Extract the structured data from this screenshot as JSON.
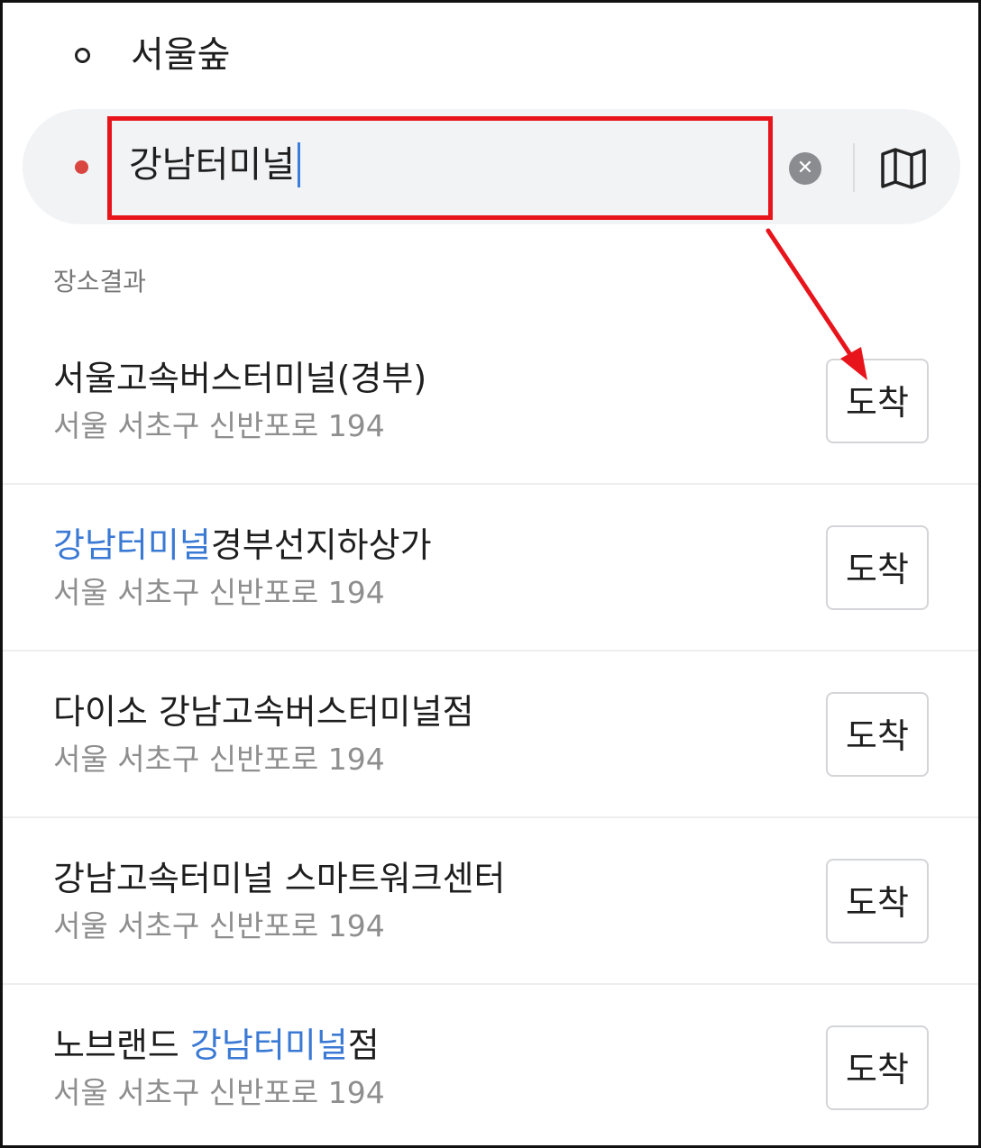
{
  "origin": {
    "label": "서울숲"
  },
  "search": {
    "value": "강남터미널"
  },
  "section": {
    "label": "장소결과"
  },
  "results": [
    {
      "pre": "서울고속버스터미널(경부)",
      "hl": "",
      "post": "",
      "address": "서울 서초구 신반포로 194",
      "button": "도착"
    },
    {
      "pre": "",
      "hl": "강남터미널",
      "post": "경부선지하상가",
      "address": "서울 서초구 신반포로 194",
      "button": "도착"
    },
    {
      "pre": "다이소 강남고속버스터미널점",
      "hl": "",
      "post": "",
      "address": "서울 서초구 신반포로 194",
      "button": "도착"
    },
    {
      "pre": "강남고속터미널 스마트워크센터",
      "hl": "",
      "post": "",
      "address": "서울 서초구 신반포로 194",
      "button": "도착"
    },
    {
      "pre": "노브랜드 ",
      "hl": "강남터미널",
      "post": "점",
      "address": "서울 서초구 신반포로 194",
      "button": "도착"
    }
  ],
  "colors": {
    "highlight": "#3a79d4",
    "annotation": "#e8141c",
    "destination_dot": "#d9453f"
  },
  "icons": {
    "clear": "close-circle-icon",
    "map": "map-icon",
    "origin": "origin-dot-icon",
    "destination": "destination-dot-icon"
  }
}
